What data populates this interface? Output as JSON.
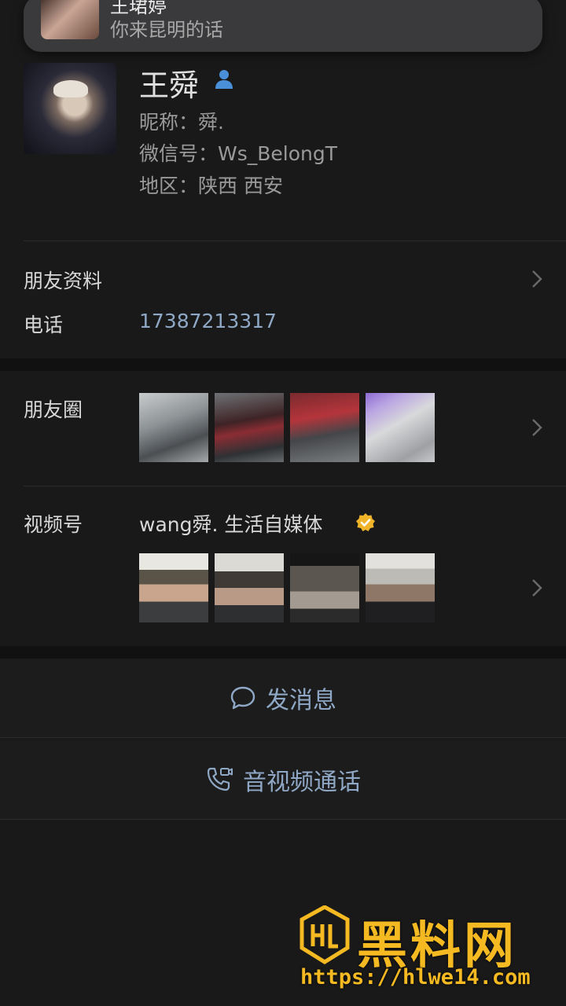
{
  "notification": {
    "sender": "王珺婷",
    "message": "你来昆明的话"
  },
  "profile": {
    "name": "王舜",
    "nickname": "昵称：舜.",
    "wechat_id": "微信号：Ws_BelongT",
    "region": "地区：陕西 西安"
  },
  "friend_info": {
    "label": "朋友资料",
    "phone_label": "电话",
    "phone_value": "17387213317"
  },
  "moments": {
    "label": "朋友圈"
  },
  "channels": {
    "label": "视频号",
    "channel_name": "wang舜. 生活自媒体"
  },
  "actions": {
    "message": "发消息",
    "call": "音视频通话"
  },
  "watermark": {
    "brand": "黑料网",
    "url": "https://hlwe14.com"
  },
  "colors": {
    "background": "#191919",
    "link_blue": "#8fa8c6",
    "verified_gold": "#f0b429",
    "watermark_gold": "#f5b922"
  }
}
